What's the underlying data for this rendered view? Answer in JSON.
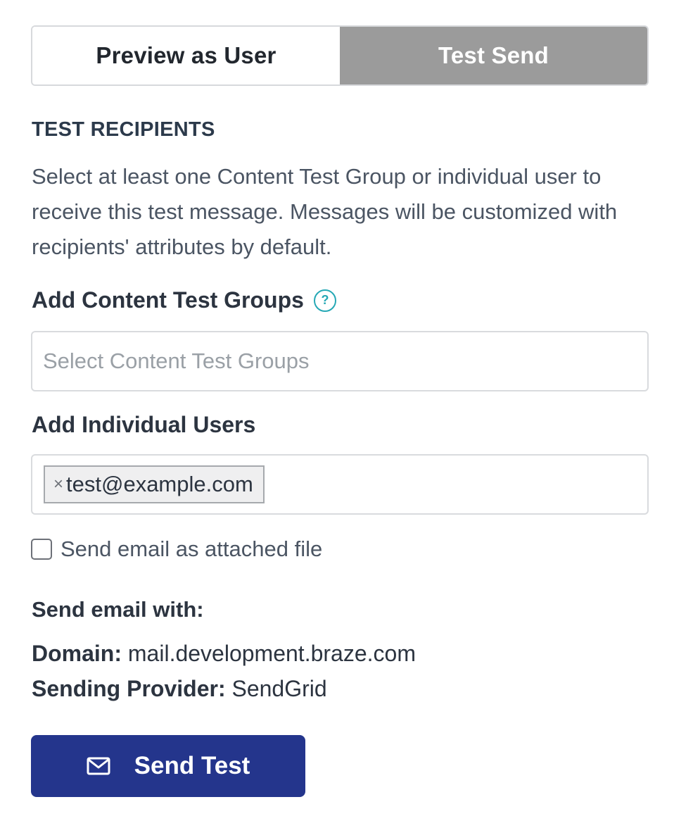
{
  "toggle": {
    "preview_label": "Preview as User",
    "test_send_label": "Test Send"
  },
  "recipients": {
    "section_title": "TEST RECIPIENTS",
    "description": "Select at least one Content Test Group or individual user to receive this test message. Messages will be customized with recipients' attributes by default."
  },
  "content_groups": {
    "label": "Add Content Test Groups",
    "help_icon": "question-circle-icon",
    "placeholder": "Select Content Test Groups"
  },
  "individual_users": {
    "label": "Add Individual Users",
    "selected": [
      "test@example.com"
    ],
    "remove_glyph": "×"
  },
  "attachment_option": {
    "label": "Send email as attached file",
    "checked": false
  },
  "sending": {
    "heading": "Send email with:",
    "domain_key": "Domain:",
    "domain_value": "mail.development.braze.com",
    "provider_key": "Sending Provider:",
    "provider_value": "SendGrid"
  },
  "send_button": {
    "label": "Send Test",
    "icon": "envelope-icon"
  },
  "colors": {
    "primary": "#24358c",
    "toggle_active": "#9b9b9b",
    "help_accent": "#25a8b5"
  }
}
